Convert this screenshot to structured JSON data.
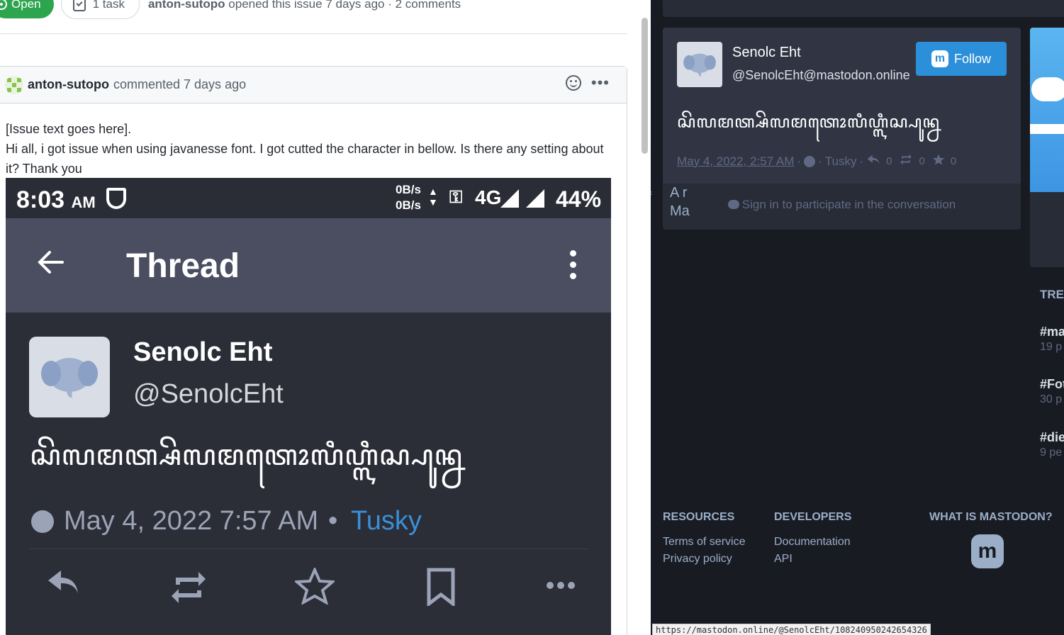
{
  "issue": {
    "state": "Open",
    "task_count": "1 task",
    "author": "anton-sutopo",
    "opened_text": "opened this issue 7 days ago · 2 comments"
  },
  "comment": {
    "author": "anton-sutopo",
    "time": "commented 7 days ago",
    "line1": "[Issue text goes here].",
    "line2": "Hi all, i got issue when using javanesse font. I got cutted the character in bellow. Is there any setting about it? Thank you"
  },
  "phone": {
    "time": "8:03",
    "ampm": "AM",
    "net_up": "0B/s",
    "net_down": "0B/s",
    "network": "4G",
    "battery": "44%",
    "toolbar_title": "Thread",
    "display_name": "Senolc Eht",
    "handle": "@SenolcEht",
    "post_text": "ꦱꦼꦭꦩꦠ꧀ꦱꦼꦭꦩꦠꦺꦴꦭꦶꦲ꧀ꦭꦶꦱ꧀ꦥꦸꦤ꧀ꦤ",
    "date": "May 4, 2022 7:57 AM",
    "dot": "•",
    "app": "Tusky"
  },
  "mastodon": {
    "display_name": "Senolc Eht",
    "handle": "@SenolcEht@mastodon.online",
    "follow_label": "Follow",
    "post_text": "ꦱꦼꦭꦩꦠ꧀ꦱꦼꦭꦩꦠꦺꦴꦭꦶꦲ꧀ꦭꦶꦱ꧀ꦥꦸꦤ꧀ꦤ",
    "date": "May 4, 2022, 2:57 AM",
    "app": "Tusky",
    "replies": "0",
    "boosts": "0",
    "favourites": "0",
    "signin": "Sign in to participate in the conversation",
    "side_text_1": "A r",
    "side_text_2": "Ma",
    "trending_heading": "TREI",
    "trends": [
      {
        "tag": "#ma",
        "count": "19 p"
      },
      {
        "tag": "#Fot",
        "count": "30 p"
      },
      {
        "tag": "#die",
        "count": "9 pe"
      }
    ],
    "footer": {
      "resources": "RESOURCES",
      "terms": "Terms of service",
      "privacy": "Privacy policy",
      "developers": "DEVELOPERS",
      "documentation": "Documentation",
      "api": "API",
      "what_is": "WHAT IS MASTODON?"
    },
    "status_url": "https://mastodon.online/@SenolcEht/108240950242654326"
  },
  "colors": {
    "github_open_green": "#2da44e",
    "mastodon_bg": "#191b22",
    "mastodon_card": "#313543",
    "mastodon_accent": "#2b90d9",
    "tusky_blue": "#3a8fd6"
  }
}
